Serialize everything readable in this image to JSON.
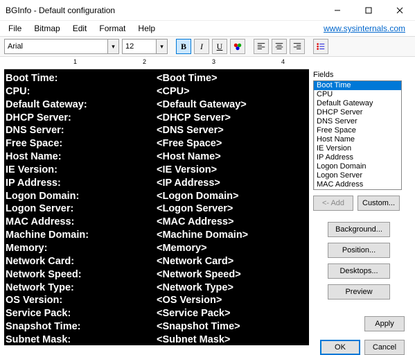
{
  "titlebar": {
    "text": "BGInfo - Default configuration"
  },
  "menubar": {
    "items": [
      "File",
      "Bitmap",
      "Edit",
      "Format",
      "Help"
    ],
    "link": "www.sysinternals.com"
  },
  "toolbar": {
    "font": "Arial",
    "size": "12",
    "bold": "B",
    "italic": "I",
    "underline": "U"
  },
  "ruler": {
    "marks": [
      "1",
      "2",
      "3",
      "4"
    ]
  },
  "editor": {
    "rows": [
      {
        "label": "Boot Time:",
        "value": "<Boot Time>"
      },
      {
        "label": "CPU:",
        "value": "<CPU>"
      },
      {
        "label": "Default Gateway:",
        "value": "<Default Gateway>"
      },
      {
        "label": "DHCP Server:",
        "value": "<DHCP Server>"
      },
      {
        "label": "DNS Server:",
        "value": "<DNS Server>"
      },
      {
        "label": "Free Space:",
        "value": "<Free Space>"
      },
      {
        "label": "Host Name:",
        "value": "<Host Name>"
      },
      {
        "label": "IE Version:",
        "value": "<IE Version>"
      },
      {
        "label": "IP Address:",
        "value": "<IP Address>"
      },
      {
        "label": "Logon Domain:",
        "value": "<Logon Domain>"
      },
      {
        "label": "Logon Server:",
        "value": "<Logon Server>"
      },
      {
        "label": "MAC Address:",
        "value": "<MAC Address>"
      },
      {
        "label": "Machine Domain:",
        "value": "<Machine Domain>"
      },
      {
        "label": "Memory:",
        "value": "<Memory>"
      },
      {
        "label": "Network Card:",
        "value": "<Network Card>"
      },
      {
        "label": "Network Speed:",
        "value": "<Network Speed>"
      },
      {
        "label": "Network Type:",
        "value": "<Network Type>"
      },
      {
        "label": "OS Version:",
        "value": "<OS Version>"
      },
      {
        "label": "Service Pack:",
        "value": "<Service Pack>"
      },
      {
        "label": "Snapshot Time:",
        "value": "<Snapshot Time>"
      },
      {
        "label": "Subnet Mask:",
        "value": "<Subnet Mask>"
      }
    ]
  },
  "side": {
    "fields_label": "Fields",
    "fields": [
      "Boot Time",
      "CPU",
      "Default Gateway",
      "DHCP Server",
      "DNS Server",
      "Free Space",
      "Host Name",
      "IE Version",
      "IP Address",
      "Logon Domain",
      "Logon Server",
      "MAC Address"
    ],
    "add": "<- Add",
    "custom": "Custom...",
    "background": "Background...",
    "position": "Position...",
    "desktops": "Desktops...",
    "preview": "Preview",
    "apply": "Apply",
    "ok": "OK",
    "cancel": "Cancel"
  }
}
